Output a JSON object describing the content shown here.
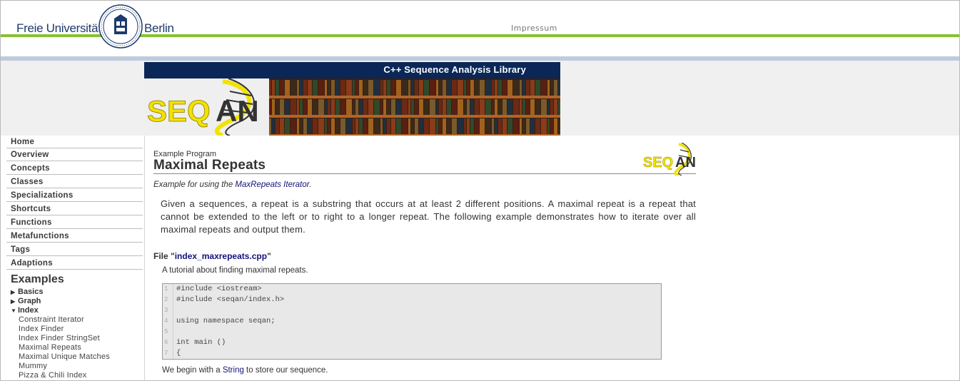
{
  "header": {
    "university_left": "Freie Universität",
    "university_right": "Berlin",
    "impressum": "Impressum"
  },
  "banner": {
    "title": "C++ Sequence Analysis Library",
    "logo_text": "SEQAN"
  },
  "sidebar": {
    "nav": [
      {
        "label": "Home"
      },
      {
        "label": "Overview"
      },
      {
        "label": "Concepts"
      },
      {
        "label": "Classes"
      },
      {
        "label": "Specializations"
      },
      {
        "label": "Shortcuts"
      },
      {
        "label": "Functions"
      },
      {
        "label": "Metafunctions"
      },
      {
        "label": "Tags"
      },
      {
        "label": "Adaptions"
      }
    ],
    "examples_title": "Examples",
    "categories": [
      {
        "label": "Basics",
        "expanded": false
      },
      {
        "label": "Graph",
        "expanded": false
      },
      {
        "label": "Index",
        "expanded": true
      }
    ],
    "index_items": [
      "Constraint Iterator",
      "Index Finder",
      "Index Finder StringSet",
      "Maximal Repeats",
      "Maximal Unique Matches",
      "Mummy",
      "Pizza & Chili Index"
    ]
  },
  "content": {
    "kicker": "Example Program",
    "title": "Maximal Repeats",
    "subtitle_prefix": "Example for using the ",
    "subtitle_link": "MaxRepeats Iterator",
    "subtitle_suffix": ".",
    "description": "Given a sequences, a repeat is a substring that occurs at at least 2 different positions. A maximal repeat is a repeat that cannot be extended to the left or to right to a longer repeat. The following example demonstrates how to iterate over all maximal repeats and output them.",
    "file_prefix": "File \"",
    "file_name": "index_maxrepeats.cpp",
    "file_suffix": "\"",
    "file_note": "A tutorial about finding maximal repeats.",
    "code_lines": [
      {
        "n": "1",
        "text": "#include <iostream>"
      },
      {
        "n": "2",
        "text": "#include <seqan/index.h>"
      },
      {
        "n": "3",
        "text": ""
      },
      {
        "n": "4",
        "text": "using namespace seqan;"
      },
      {
        "n": "5",
        "text": ""
      },
      {
        "n": "6",
        "text": "int main ()"
      },
      {
        "n": "7",
        "text": "{"
      }
    ],
    "after_prefix": "We begin with a ",
    "after_link": "String",
    "after_suffix": " to store our sequence."
  },
  "colors": {
    "header_green": "#86c232",
    "header_navy": "#0a2758",
    "link": "#13137a"
  }
}
